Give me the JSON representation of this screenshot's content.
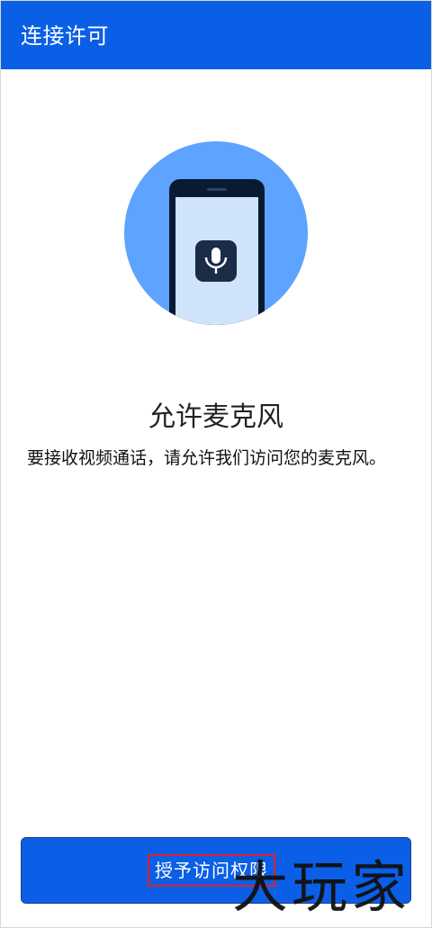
{
  "appbar": {
    "title": "连接许可"
  },
  "illustration": {
    "icon": "microphone-icon",
    "circle_color": "#5ea3ff",
    "phone_color": "#0b1a33",
    "screen_color": "#cfe3fb"
  },
  "content": {
    "heading": "允许麦克风",
    "description": "要接收视频通话，请允许我们访问您的麦克风。"
  },
  "actions": {
    "grant_label": "授予访问权限"
  },
  "watermark": {
    "text": "大玩家"
  },
  "colors": {
    "primary": "#0a5fe6",
    "highlight_box": "#e0202a"
  }
}
